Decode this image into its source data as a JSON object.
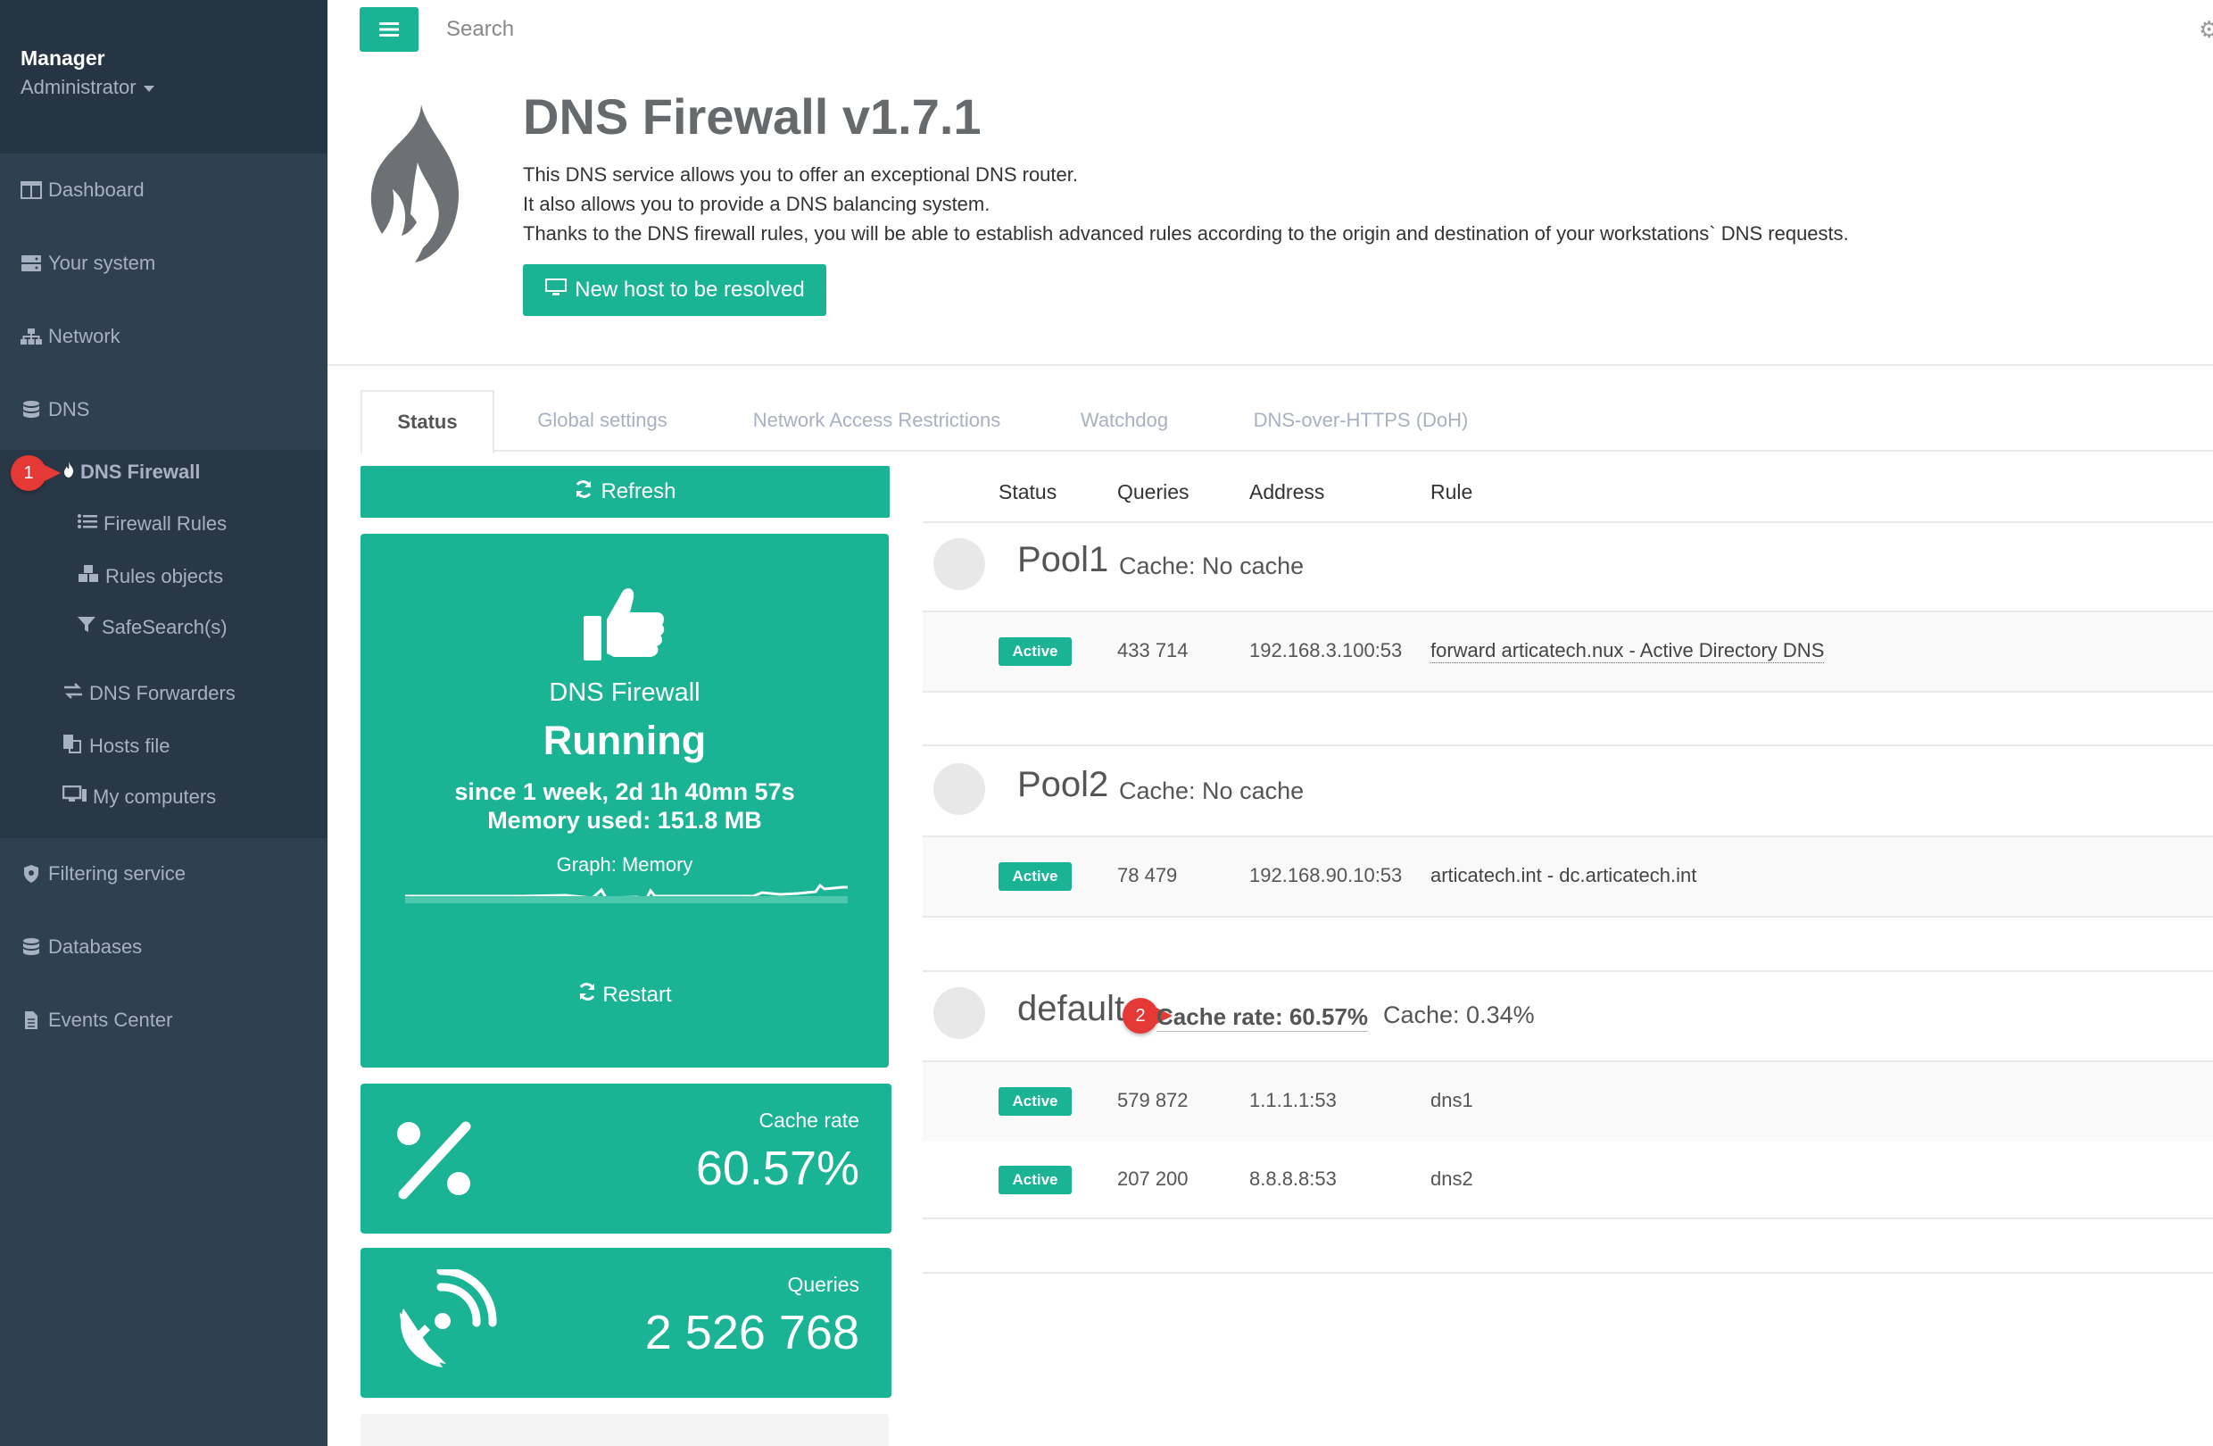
{
  "profile": {
    "name": "Manager",
    "role": "Administrator"
  },
  "sidebar": {
    "items": [
      {
        "label": "Dashboard"
      },
      {
        "label": "Your system"
      },
      {
        "label": "Network"
      },
      {
        "label": "DNS"
      },
      {
        "label": "DNS Firewall"
      },
      {
        "label": "Firewall Rules"
      },
      {
        "label": "Rules objects"
      },
      {
        "label": "SafeSearch(s)"
      },
      {
        "label": "DNS Forwarders"
      },
      {
        "label": "Hosts file"
      },
      {
        "label": "My computers"
      },
      {
        "label": "Filtering service"
      },
      {
        "label": "Databases"
      },
      {
        "label": "Events Center"
      }
    ]
  },
  "markers": {
    "m1": "1",
    "m2": "2"
  },
  "topbar": {
    "search_placeholder": "Search"
  },
  "header": {
    "title": "DNS Firewall v1.7.1",
    "line1": "This DNS service allows you to offer an exceptional DNS router.",
    "line2": "It also allows you to provide a DNS balancing system.",
    "line3": "Thanks to the DNS firewall rules, you will be able to establish advanced rules according to the origin and destination of your workstations` DNS requests.",
    "new_host_label": "New host to be resolved"
  },
  "tabs": [
    "Status",
    "Global settings",
    "Network Access Restrictions",
    "Watchdog",
    "DNS-over-HTTPS (DoH)"
  ],
  "left": {
    "refresh_label": "Refresh",
    "service": "DNS Firewall",
    "state": "Running",
    "since": "since 1 week, 2d 1h 40mn 57s",
    "memory": "Memory used: 151.8 MB",
    "graph_label": "Graph: Memory",
    "restart_label": "Restart",
    "cache_rate_label": "Cache rate",
    "cache_rate_value": "60.57%",
    "queries_label": "Queries",
    "queries_value": "2 526 768"
  },
  "table": {
    "headers": [
      "Status",
      "Queries",
      "Address",
      "Rule"
    ],
    "pools": [
      {
        "name": "Pool1",
        "cache": "Cache: No cache",
        "rows": [
          {
            "status": "Active",
            "queries": "433 714",
            "address": "192.168.3.100:53",
            "rule": "forward articatech.nux - Active Directory DNS"
          }
        ]
      },
      {
        "name": "Pool2",
        "cache": "Cache: No cache",
        "rows": [
          {
            "status": "Active",
            "queries": "78 479",
            "address": "192.168.90.10:53",
            "rule": "articatech.int - dc.articatech.int"
          }
        ]
      },
      {
        "name": "default",
        "cache_rate": "Cache rate: 60.57%",
        "cache": "Cache: 0.34%",
        "rows": [
          {
            "status": "Active",
            "queries": "579 872",
            "address": "1.1.1.1:53",
            "rule": "dns1"
          },
          {
            "status": "Active",
            "queries": "207 200",
            "address": "8.8.8.8:53",
            "rule": "dns2"
          }
        ]
      }
    ]
  },
  "colors": {
    "accent": "#1ab394",
    "sidebar": "#2f4050",
    "marker": "#e53935"
  }
}
